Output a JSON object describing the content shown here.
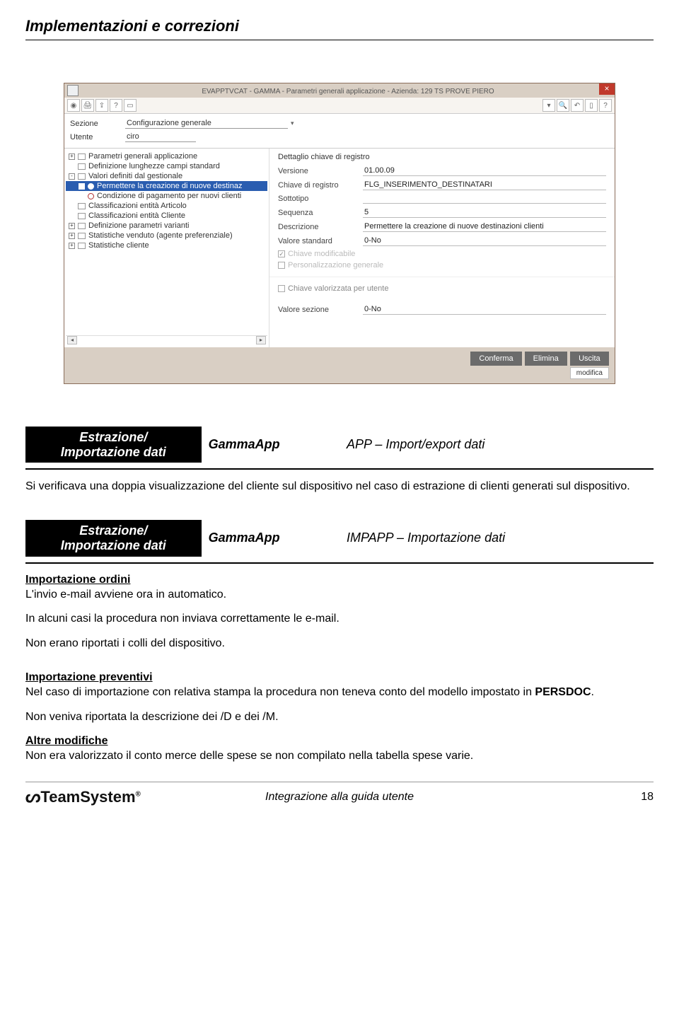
{
  "page": {
    "header_title": "Implementazioni e correzioni",
    "footer_center": "Integrazione alla guida utente",
    "footer_page": "18",
    "logo_text": "TeamSystem"
  },
  "app": {
    "title": "EVAPPTVCAT - GAMMA - Parametri generali applicazione - Azienda: 129 TS PROVE PIERO",
    "form": {
      "sezione_label": "Sezione",
      "sezione_value": "Configurazione generale",
      "utente_label": "Utente",
      "utente_value": "ciro"
    },
    "tree": [
      {
        "label": "Parametri generali applicazione",
        "level": 1,
        "exp": "+",
        "icon": "folder"
      },
      {
        "label": "Definizione lunghezze campi standard",
        "level": 1,
        "exp": "",
        "icon": "folder"
      },
      {
        "label": "Valori definiti dal gestionale",
        "level": 1,
        "exp": "-",
        "icon": "folder"
      },
      {
        "label": "Permettere la creazione di nuove destinaz",
        "level": 2,
        "exp": "",
        "icon": "radio",
        "selected": true
      },
      {
        "label": "Condizione di pagamento per nuovi clienti",
        "level": 2,
        "exp": "",
        "icon": "radio"
      },
      {
        "label": "Classificazioni entità Articolo",
        "level": 1,
        "exp": "",
        "icon": "folder"
      },
      {
        "label": "Classificazioni entità Cliente",
        "level": 1,
        "exp": "",
        "icon": "folder"
      },
      {
        "label": "Definizione parametri varianti",
        "level": 1,
        "exp": "+",
        "icon": "folder"
      },
      {
        "label": "Statistiche venduto (agente preferenziale)",
        "level": 1,
        "exp": "+",
        "icon": "folder"
      },
      {
        "label": "Statistiche cliente",
        "level": 1,
        "exp": "+",
        "icon": "folder"
      }
    ],
    "detail": {
      "heading": "Dettaglio chiave di registro",
      "versione_label": "Versione",
      "versione_value": "01.00.09",
      "chiave_label": "Chiave di registro",
      "chiave_value": "FLG_INSERIMENTO_DESTINATARI",
      "sottotipo_label": "Sottotipo",
      "sottotipo_value": "",
      "sequenza_label": "Sequenza",
      "sequenza_value": "5",
      "descrizione_label": "Descrizione",
      "descrizione_value": "Permettere la creazione di nuove destinazioni clienti",
      "valore_std_label": "Valore standard",
      "valore_std_value": "0-No",
      "chk_modificabile": "Chiave modificabile",
      "chk_personalizzazione": "Personalizzazione generale",
      "chk_valorizzata": "Chiave valorizzata per utente",
      "valore_sez_label": "Valore sezione",
      "valore_sez_value": "0-No"
    },
    "footer_buttons": {
      "conferma": "Conferma",
      "elimina": "Elimina",
      "uscita": "Uscita",
      "modifica": "modifica"
    }
  },
  "doc": {
    "section1": {
      "col1_line1": "Estrazione/",
      "col1_line2": "Importazione dati",
      "col2": "GammaApp",
      "col3": "APP – Import/export dati",
      "body": "Si verificava una doppia visualizzazione del cliente sul dispositivo nel caso di estrazione di clienti generati sul dispositivo."
    },
    "section2": {
      "col1_line1": "Estrazione/",
      "col1_line2": "Importazione dati",
      "col2": "GammaApp",
      "col3": "IMPAPP – Importazione dati",
      "sub1_head": "Importazione ordini",
      "sub1_p1": "L'invio e-mail avviene ora in automatico.",
      "sub1_p2": "In alcuni casi la procedura non inviava correttamente le e-mail.",
      "sub1_p3": "Non erano riportati i colli del dispositivo.",
      "sub2_head": "Importazione preventivi",
      "sub2_p1_a": "Nel caso di importazione con relativa stampa la procedura non teneva conto del modello impostato in ",
      "sub2_p1_b": "PERSDOC",
      "sub2_p1_c": ".",
      "sub2_p2": "Non veniva riportata la descrizione dei /D e dei /M.",
      "sub3_head": "Altre modifiche",
      "sub3_p1": "Non era valorizzato il conto merce delle spese se non compilato nella tabella spese varie."
    }
  }
}
